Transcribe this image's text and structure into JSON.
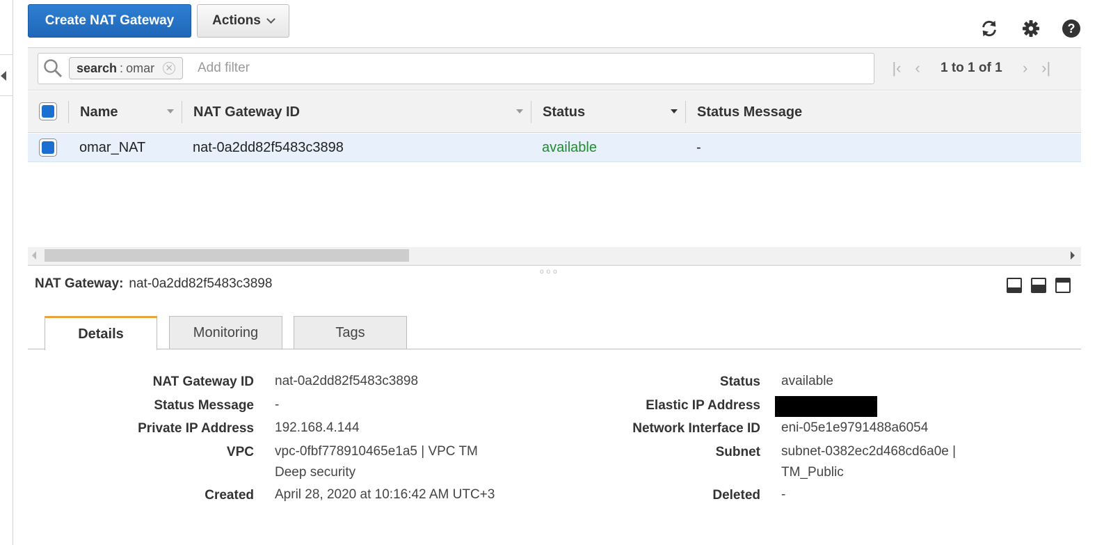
{
  "toolbar": {
    "create_label": "Create NAT Gateway",
    "actions_label": "Actions",
    "icons": [
      "refresh-icon",
      "gear-icon",
      "help-icon"
    ]
  },
  "filter": {
    "chip_key": "search",
    "chip_sep": " : ",
    "chip_value": "omar",
    "placeholder": "Add filter",
    "pagination_text": "1 to 1 of 1"
  },
  "table": {
    "columns": [
      "Name",
      "NAT Gateway ID",
      "Status",
      "Status Message"
    ],
    "rows": [
      {
        "name": "omar_NAT",
        "id": "nat-0a2dd82f5483c3898",
        "status": "available",
        "message": "-"
      }
    ]
  },
  "detail": {
    "title_label": "NAT Gateway:",
    "title_value": "nat-0a2dd82f5483c3898",
    "tabs": [
      "Details",
      "Monitoring",
      "Tags"
    ],
    "left": {
      "nat_gateway_id": {
        "label": "NAT Gateway ID",
        "value": "nat-0a2dd82f5483c3898"
      },
      "status_message": {
        "label": "Status Message",
        "value": "-"
      },
      "private_ip": {
        "label": "Private IP Address",
        "value": "192.168.4.144"
      },
      "vpc": {
        "label": "VPC",
        "value_line1": "vpc-0fbf778910465e1a5 | VPC TM",
        "value_line2": "Deep security"
      },
      "created": {
        "label": "Created",
        "value": "April 28, 2020 at 10:16:42 AM UTC+3"
      }
    },
    "right": {
      "status": {
        "label": "Status",
        "value": "available"
      },
      "elastic_ip": {
        "label": "Elastic IP Address"
      },
      "network_interface": {
        "label": "Network Interface ID",
        "value": "eni-05e1e9791488a6054"
      },
      "subnet": {
        "label": "Subnet",
        "value_line1": "subnet-0382ec2d468cd6a0e |",
        "value_line2": "TM_Public"
      },
      "deleted": {
        "label": "Deleted",
        "value": "-"
      }
    }
  },
  "colors": {
    "primary": "#1f67b8",
    "status_available": "#1e8c2f",
    "link": "#1f62a8",
    "active_tab_accent": "#e8a33c"
  }
}
